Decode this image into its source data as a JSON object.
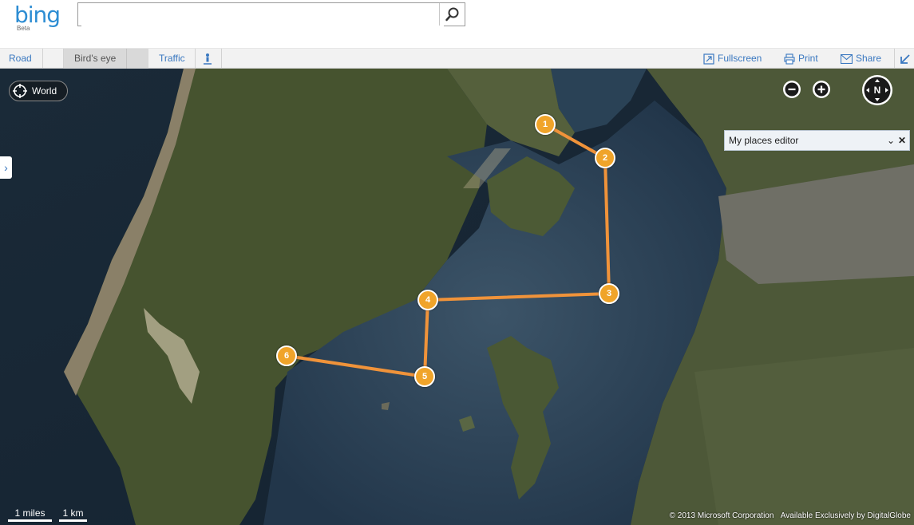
{
  "header": {
    "logo": "bing",
    "logo_sub": "Beta",
    "search": {
      "value": "",
      "placeholder": ""
    }
  },
  "toolbar": {
    "road": "Road",
    "birds_eye": "Bird's eye",
    "traffic": "Traffic",
    "fullscreen": "Fullscreen",
    "print": "Print",
    "share": "Share"
  },
  "map": {
    "world_label": "World",
    "compass_label": "N",
    "places_editor_title": "My places editor",
    "scale_miles": "1 miles",
    "scale_km": "1 km",
    "copyright": "© 2013 Microsoft Corporation",
    "imagery_credit": "Available Exclusively by DigitalGlobe",
    "route_color": "#f0a42a",
    "markers": [
      "1",
      "2",
      "3",
      "4",
      "5",
      "6"
    ]
  }
}
